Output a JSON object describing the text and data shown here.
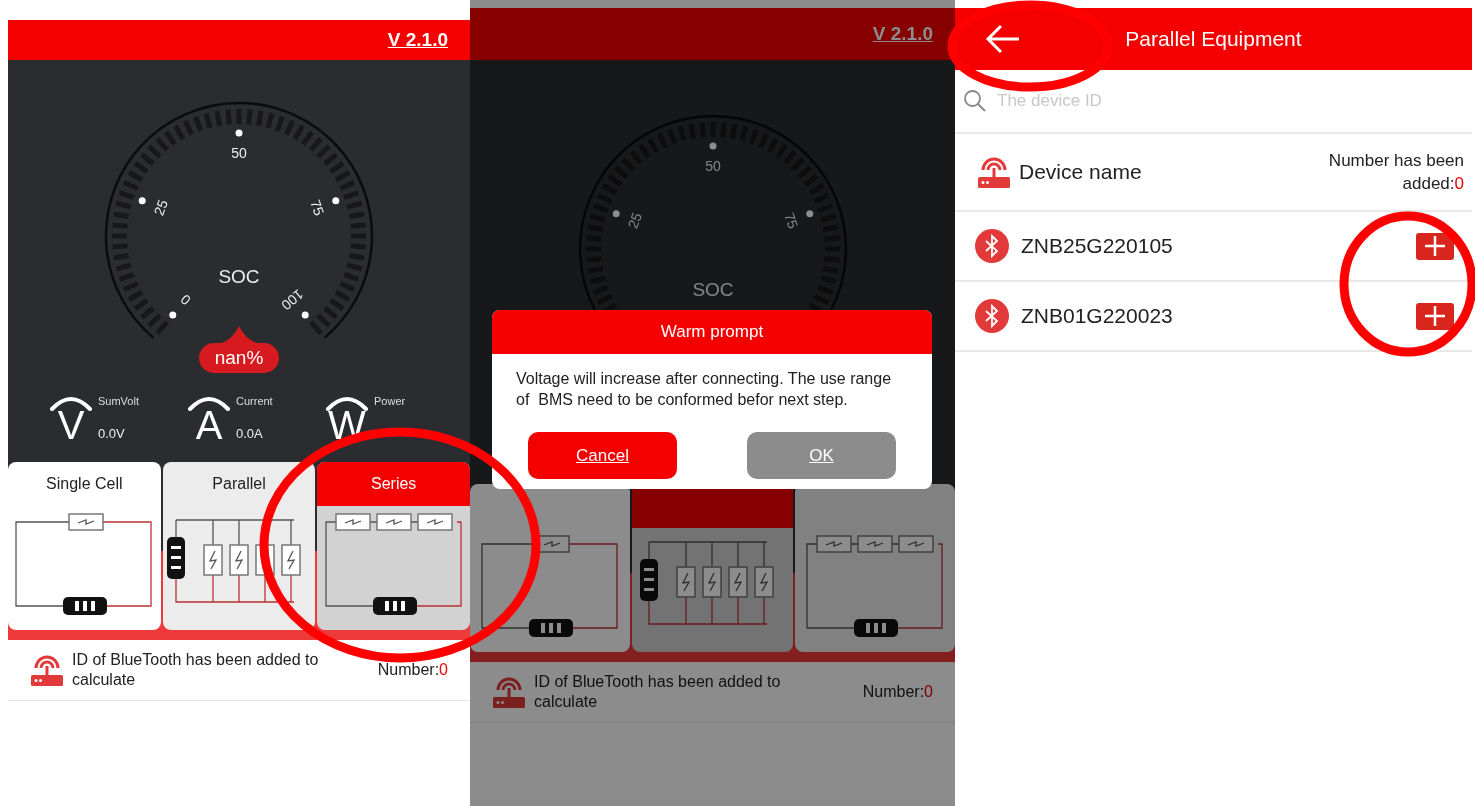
{
  "screens": [
    {
      "kind": "home",
      "header": {
        "version": "V 2.1.0"
      },
      "gauge": {
        "label": "SOC",
        "ticks": [
          {
            "label": "0"
          },
          {
            "label": "25"
          },
          {
            "label": "50"
          },
          {
            "label": "75"
          },
          {
            "label": "100"
          }
        ],
        "reading": "nan%"
      },
      "metrics": [
        {
          "symbol": "V",
          "label": "SumVolt",
          "value": "0.0V"
        },
        {
          "symbol": "A",
          "label": "Current",
          "value": "0.0A"
        },
        {
          "symbol": "W",
          "label": "Power"
        }
      ],
      "tabs": [
        {
          "label": "Single Cell",
          "kind": "single",
          "selected": false
        },
        {
          "label": "Parallel",
          "kind": "parallel",
          "selected": false
        },
        {
          "label": "Series",
          "kind": "series",
          "selected": true
        }
      ],
      "info": {
        "text": "ID of BlueTooth has been added to calculate",
        "count_label": "Number:",
        "count": "0"
      }
    },
    {
      "kind": "home",
      "dimmed": true,
      "header": {
        "version": "V 2.1.0"
      },
      "gauge": {
        "label": "SOC",
        "ticks": [
          {
            "label": "25"
          },
          {
            "label": "50"
          },
          {
            "label": "75"
          }
        ]
      },
      "tabs": [
        {
          "kind": "single",
          "selected": false
        },
        {
          "kind": "parallel",
          "selected": true
        },
        {
          "kind": "series",
          "selected": false
        }
      ],
      "info": {
        "text": "ID of BlueTooth has been added to calculate",
        "count_label": "Number:",
        "count": "0"
      },
      "dialog": {
        "title": "Warm prompt",
        "message": "Voltage will increase after connecting. The use range of  BMS need to be conformed befor next step.",
        "buttons": [
          {
            "label": "Cancel",
            "kind": "cancel"
          },
          {
            "label": "OK",
            "kind": "confirm"
          }
        ]
      }
    },
    {
      "kind": "device_list",
      "title": "Parallel Equipment",
      "search": {
        "placeholder": "The device ID"
      },
      "list_header": {
        "label": "Device name",
        "count_label": "Number has been added:",
        "count": "0"
      },
      "devices": [
        {
          "id": "ZNB25G220105"
        },
        {
          "id": "ZNB01G220023"
        }
      ]
    }
  ],
  "annotations": [
    {
      "kind": "ellipse"
    },
    {
      "kind": "ellipse"
    },
    {
      "kind": "ellipse"
    }
  ]
}
